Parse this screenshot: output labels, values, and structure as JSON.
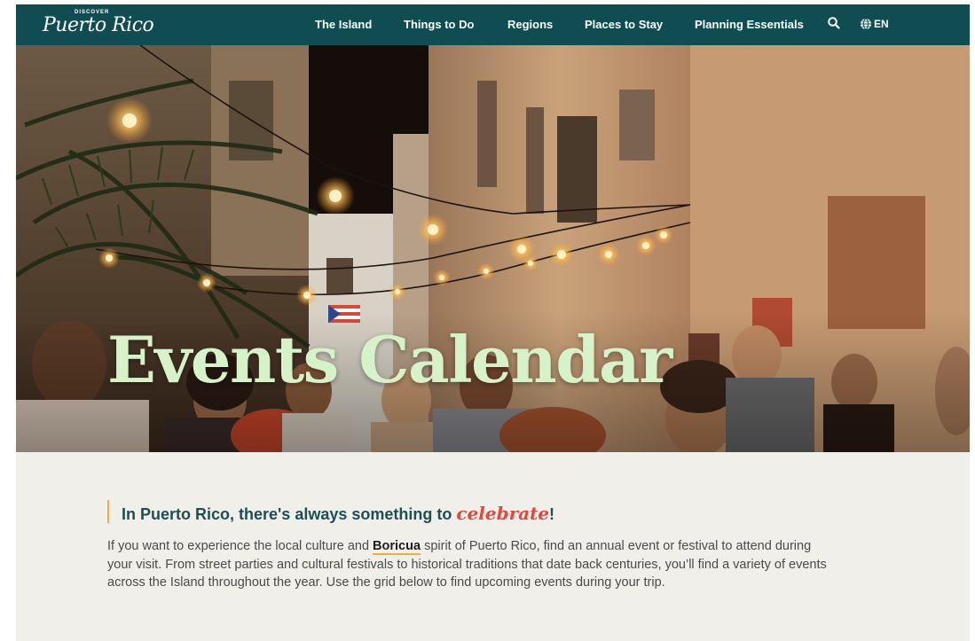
{
  "header": {
    "logo_small": "DISCOVER",
    "logo_text": "Puerto Rico",
    "nav": [
      "The Island",
      "Things to Do",
      "Regions",
      "Places to Stay",
      "Planning Essentials"
    ],
    "language": "EN"
  },
  "hero": {
    "title": "Events Calendar"
  },
  "intro": {
    "heading_prefix": "In Puerto Rico, there's always something to ",
    "heading_accent": "celebrate",
    "heading_suffix": "!",
    "para_before_link": "If you want to experience the local culture and ",
    "para_link": "Boricua",
    "para_after_link": " spirit of Puerto Rico, find an annual event or festival to attend during your visit. From street parties and cultural festivals to historical traditions that date back centuries, you’ll find a variety of events across the Island throughout the year. Use the grid below to find upcoming events during your trip."
  },
  "colors": {
    "nav_bg": "#0f4d52",
    "hero_title": "#d6f2c9",
    "heading": "#1d4e56",
    "accent": "#e2483b",
    "underline": "#e8b04a",
    "content_bg": "#f1efea"
  }
}
